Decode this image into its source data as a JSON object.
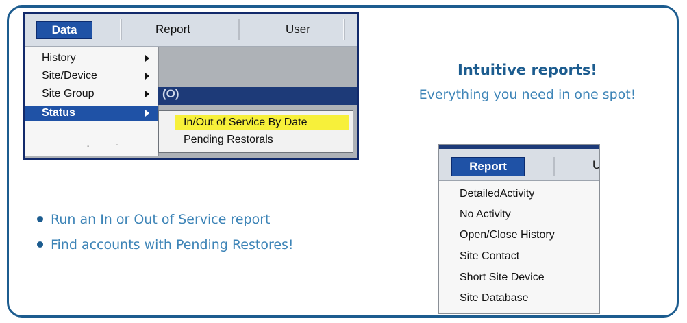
{
  "data_menu": {
    "menubar": {
      "data": "Data",
      "report": "Report",
      "user": "User"
    },
    "items": [
      {
        "label": "History",
        "has_submenu": true
      },
      {
        "label": "Site/Device",
        "has_submenu": true
      },
      {
        "label": "Site Group",
        "has_submenu": true
      },
      {
        "label": "Status",
        "has_submenu": true,
        "selected": true
      }
    ],
    "background_fragment": "(O)",
    "status_submenu": [
      "In/Out of Service By Date",
      "Pending Restorals"
    ],
    "highlight_color": "#f7f03a",
    "selection_color": "#1f52a6"
  },
  "headline": "Intuitive reports!",
  "subheadline": "Everything you need in one spot!",
  "bullets": [
    "Run an In or Out of Service report",
    "Find accounts with Pending Restores!"
  ],
  "report_menu": {
    "menubar": {
      "report": "Report",
      "next_fragment": "U"
    },
    "items": [
      "DetailedActivity",
      "No Activity",
      "Open/Close History",
      "Site Contact",
      "Short Site Device",
      "Site Database"
    ]
  },
  "colors": {
    "border": "#1c5c8f",
    "text_blue": "#3d84b7"
  }
}
